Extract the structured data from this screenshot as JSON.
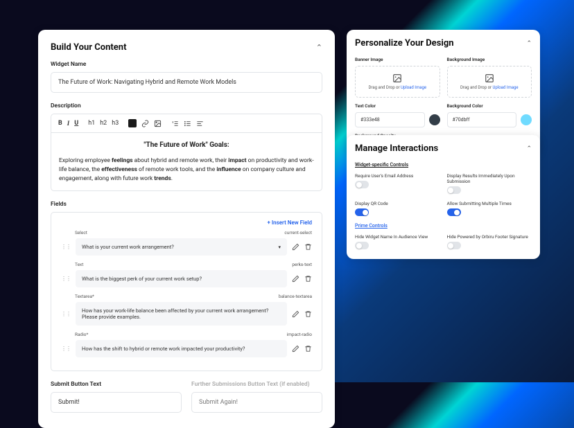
{
  "build": {
    "title": "Build Your Content",
    "widgetNameLabel": "Widget Name",
    "widgetName": "The Future of Work: Navigating Hybrid and Remote Work Models",
    "descLabel": "Description",
    "editorTitle": "\"The Future of Work\" Goals:",
    "editorBody": "Exploring employee <b>feelings</b> about hybrid and remote work, their <b>impact</b> on productivity and work-life balance, the <b>effectiveness</b> of remote work tools, and the <b>influence</b> on company culture and engagement, along with future work <b>trends</b>.",
    "fieldsLabel": "Fields",
    "insertField": "+ Insert New Field",
    "fields": [
      {
        "type": "Select",
        "slug": "current-select",
        "text": "What is your current work arrangement?",
        "sel": true
      },
      {
        "type": "Text",
        "slug": "perks-text",
        "text": "What is the biggest perk of your current work setup?"
      },
      {
        "type": "Textarea*",
        "slug": "balance-textarea",
        "text": "How has your work-life balance been affected by your current work arrangement? Please provide examples."
      },
      {
        "type": "Radio*",
        "slug": "impact-radio",
        "text": "How has the shift to hybrid or remote work impacted your productivity?"
      }
    ],
    "submitLbl": "Submit Button Text",
    "submitVal": "Submit!",
    "furtherLbl": "Further Submissions Button Text (if enabled)",
    "furtherPh": "Submit Again!"
  },
  "design": {
    "title": "Personalize Your Design",
    "bannerLbl": "Banner Image",
    "bgImgLbl": "Background Image",
    "dragDrop": "Drag and Drop or ",
    "uploadTxt": "Upload Image",
    "textColorLbl": "Text Color",
    "textColor": "#333e48",
    "bgColorLbl": "Background Color",
    "bgColor": "#70dbff",
    "opacityLbl": "Background Opacity"
  },
  "interact": {
    "title": "Manage Interactions",
    "widgetCtrl": "Widget-specific Controls",
    "primeCtrl": "Prime Controls",
    "t1": "Require User's Email Address",
    "t2": "Display Results Immediately Upon Submission",
    "t3": "Display QR Code",
    "t4": "Allow Submitting Multiple Times",
    "t5": "Hide Widget Name In Audience View",
    "t6": "Hide Powered by Orbiru Footer Signature"
  }
}
